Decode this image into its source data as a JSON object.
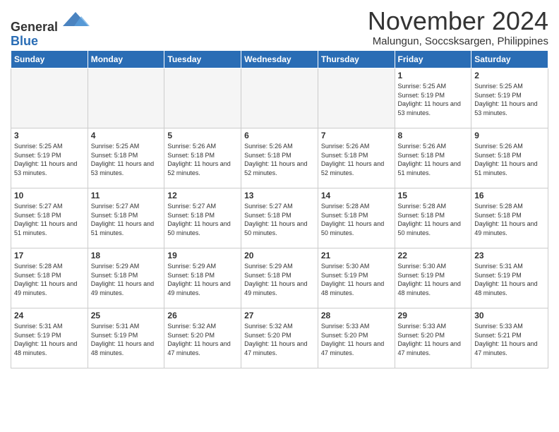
{
  "header": {
    "logo_general": "General",
    "logo_blue": "Blue",
    "month": "November 2024",
    "location": "Malungun, Soccsksargen, Philippines"
  },
  "weekdays": [
    "Sunday",
    "Monday",
    "Tuesday",
    "Wednesday",
    "Thursday",
    "Friday",
    "Saturday"
  ],
  "weeks": [
    [
      {
        "day": "",
        "empty": true
      },
      {
        "day": "",
        "empty": true
      },
      {
        "day": "",
        "empty": true
      },
      {
        "day": "",
        "empty": true
      },
      {
        "day": "",
        "empty": true
      },
      {
        "day": "1",
        "sunrise": "5:25 AM",
        "sunset": "5:19 PM",
        "daylight": "11 hours and 53 minutes."
      },
      {
        "day": "2",
        "sunrise": "5:25 AM",
        "sunset": "5:19 PM",
        "daylight": "11 hours and 53 minutes."
      }
    ],
    [
      {
        "day": "3",
        "sunrise": "5:25 AM",
        "sunset": "5:19 PM",
        "daylight": "11 hours and 53 minutes."
      },
      {
        "day": "4",
        "sunrise": "5:25 AM",
        "sunset": "5:18 PM",
        "daylight": "11 hours and 53 minutes."
      },
      {
        "day": "5",
        "sunrise": "5:26 AM",
        "sunset": "5:18 PM",
        "daylight": "11 hours and 52 minutes."
      },
      {
        "day": "6",
        "sunrise": "5:26 AM",
        "sunset": "5:18 PM",
        "daylight": "11 hours and 52 minutes."
      },
      {
        "day": "7",
        "sunrise": "5:26 AM",
        "sunset": "5:18 PM",
        "daylight": "11 hours and 52 minutes."
      },
      {
        "day": "8",
        "sunrise": "5:26 AM",
        "sunset": "5:18 PM",
        "daylight": "11 hours and 51 minutes."
      },
      {
        "day": "9",
        "sunrise": "5:26 AM",
        "sunset": "5:18 PM",
        "daylight": "11 hours and 51 minutes."
      }
    ],
    [
      {
        "day": "10",
        "sunrise": "5:27 AM",
        "sunset": "5:18 PM",
        "daylight": "11 hours and 51 minutes."
      },
      {
        "day": "11",
        "sunrise": "5:27 AM",
        "sunset": "5:18 PM",
        "daylight": "11 hours and 51 minutes."
      },
      {
        "day": "12",
        "sunrise": "5:27 AM",
        "sunset": "5:18 PM",
        "daylight": "11 hours and 50 minutes."
      },
      {
        "day": "13",
        "sunrise": "5:27 AM",
        "sunset": "5:18 PM",
        "daylight": "11 hours and 50 minutes."
      },
      {
        "day": "14",
        "sunrise": "5:28 AM",
        "sunset": "5:18 PM",
        "daylight": "11 hours and 50 minutes."
      },
      {
        "day": "15",
        "sunrise": "5:28 AM",
        "sunset": "5:18 PM",
        "daylight": "11 hours and 50 minutes."
      },
      {
        "day": "16",
        "sunrise": "5:28 AM",
        "sunset": "5:18 PM",
        "daylight": "11 hours and 49 minutes."
      }
    ],
    [
      {
        "day": "17",
        "sunrise": "5:28 AM",
        "sunset": "5:18 PM",
        "daylight": "11 hours and 49 minutes."
      },
      {
        "day": "18",
        "sunrise": "5:29 AM",
        "sunset": "5:18 PM",
        "daylight": "11 hours and 49 minutes."
      },
      {
        "day": "19",
        "sunrise": "5:29 AM",
        "sunset": "5:18 PM",
        "daylight": "11 hours and 49 minutes."
      },
      {
        "day": "20",
        "sunrise": "5:29 AM",
        "sunset": "5:18 PM",
        "daylight": "11 hours and 49 minutes."
      },
      {
        "day": "21",
        "sunrise": "5:30 AM",
        "sunset": "5:19 PM",
        "daylight": "11 hours and 48 minutes."
      },
      {
        "day": "22",
        "sunrise": "5:30 AM",
        "sunset": "5:19 PM",
        "daylight": "11 hours and 48 minutes."
      },
      {
        "day": "23",
        "sunrise": "5:31 AM",
        "sunset": "5:19 PM",
        "daylight": "11 hours and 48 minutes."
      }
    ],
    [
      {
        "day": "24",
        "sunrise": "5:31 AM",
        "sunset": "5:19 PM",
        "daylight": "11 hours and 48 minutes."
      },
      {
        "day": "25",
        "sunrise": "5:31 AM",
        "sunset": "5:19 PM",
        "daylight": "11 hours and 48 minutes."
      },
      {
        "day": "26",
        "sunrise": "5:32 AM",
        "sunset": "5:20 PM",
        "daylight": "11 hours and 47 minutes."
      },
      {
        "day": "27",
        "sunrise": "5:32 AM",
        "sunset": "5:20 PM",
        "daylight": "11 hours and 47 minutes."
      },
      {
        "day": "28",
        "sunrise": "5:33 AM",
        "sunset": "5:20 PM",
        "daylight": "11 hours and 47 minutes."
      },
      {
        "day": "29",
        "sunrise": "5:33 AM",
        "sunset": "5:20 PM",
        "daylight": "11 hours and 47 minutes."
      },
      {
        "day": "30",
        "sunrise": "5:33 AM",
        "sunset": "5:21 PM",
        "daylight": "11 hours and 47 minutes."
      }
    ]
  ]
}
